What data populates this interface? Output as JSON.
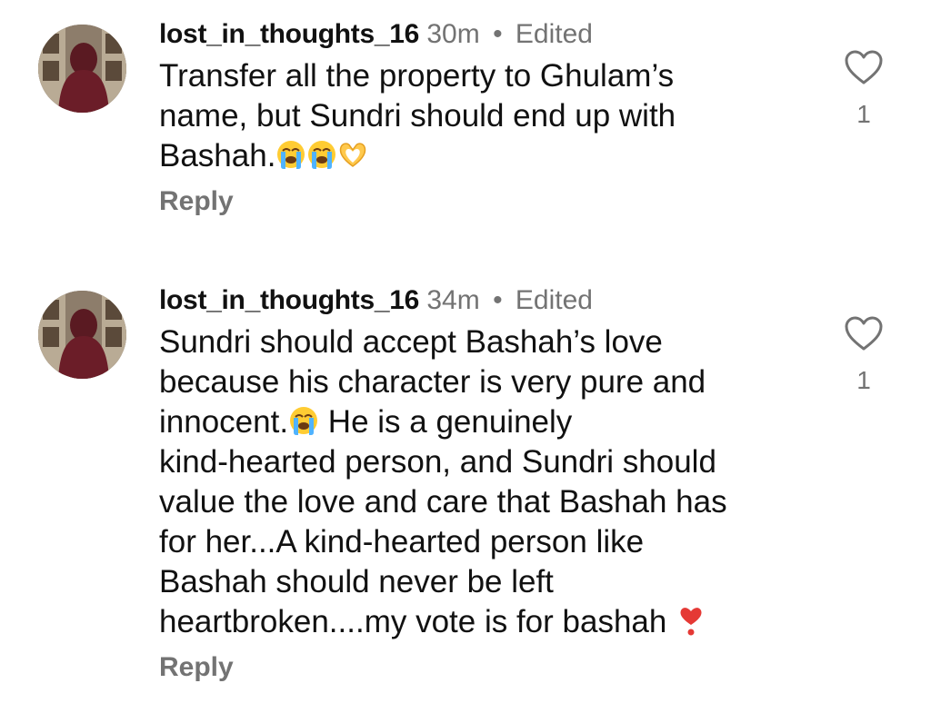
{
  "comments": [
    {
      "username": "lost_in_thoughts_16",
      "time": "30m",
      "separator": "•",
      "edited": "Edited",
      "lines": [
        "Transfer all the property to Ghulam’s",
        "name, but Sundri should end up with",
        "Bashah."
      ],
      "emojis_after_last_line": [
        "loudly-crying-face-emoji",
        "loudly-crying-face-emoji",
        "heart-hands-emoji"
      ],
      "reply_label": "Reply",
      "like_icon": "heart-outline-icon",
      "like_count": "1"
    },
    {
      "username": "lost_in_thoughts_16",
      "time": "34m",
      "separator": "•",
      "edited": "Edited",
      "lines": [
        "Sundri should accept Bashah’s love",
        "because his character is very pure and",
        "innocent.",
        " He is a genuinely",
        "kind-hearted person, and Sundri should",
        "value the love and care that Bashah has",
        "for her...A kind-hearted person like",
        "Bashah should never be left",
        "heartbroken....my vote is for bashah "
      ],
      "emojis": [
        "loudly-crying-face-emoji",
        "heart-exclamation-emoji"
      ],
      "reply_label": "Reply",
      "like_icon": "heart-outline-icon",
      "like_count": "1"
    }
  ],
  "colors": {
    "text": "#111111",
    "secondary": "#737373",
    "background": "#ffffff"
  }
}
